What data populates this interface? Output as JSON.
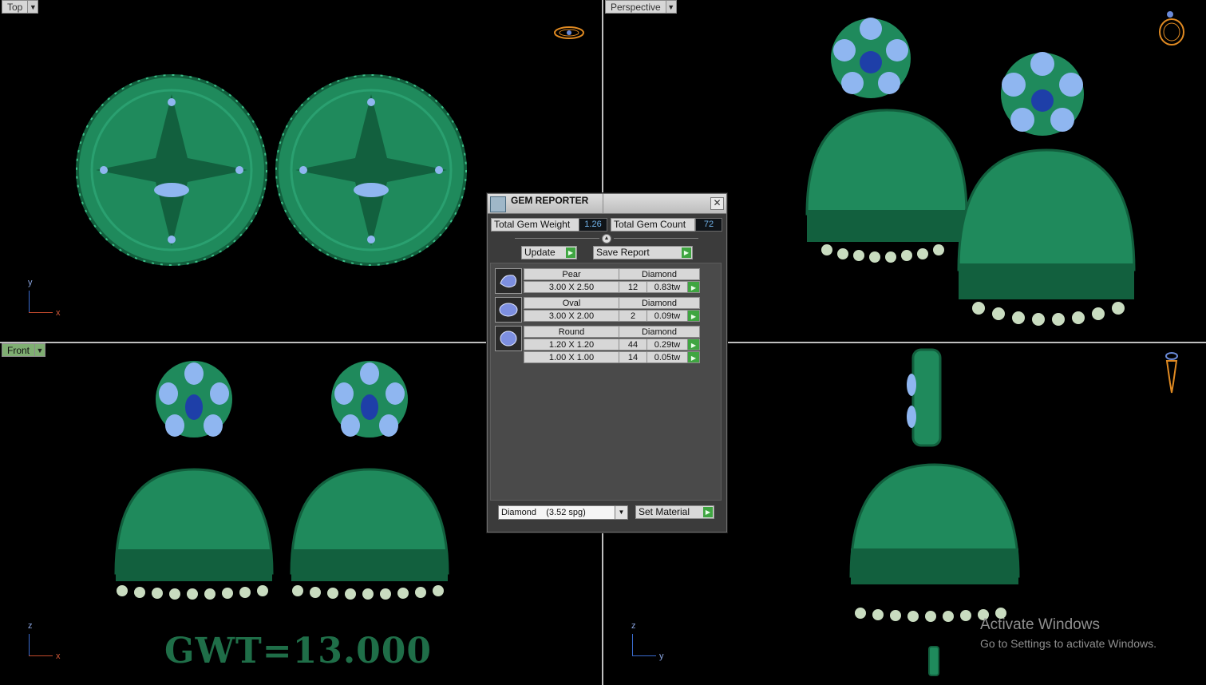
{
  "viewports": {
    "top": {
      "label": "Top"
    },
    "perspective": {
      "label": "Perspective"
    },
    "front": {
      "label": "Front"
    },
    "right": {
      "label": ""
    }
  },
  "axes": {
    "top": {
      "vertical": "y",
      "horizontal": "x"
    },
    "front": {
      "vertical": "z",
      "horizontal": "x"
    },
    "right": {
      "vertical": "z",
      "horizontal": "y"
    }
  },
  "overlay": {
    "gwt_text": "GWT=13.000",
    "watermark_title": "Activate Windows",
    "watermark_sub": "Go to Settings to activate Windows."
  },
  "gem_reporter": {
    "title": "GEM REPORTER",
    "close_symbol": "✕",
    "total_weight_label": "Total Gem Weight",
    "total_weight_value": "1.26",
    "total_count_label": "Total Gem Count",
    "total_count_value": "72",
    "update_label": "Update",
    "save_report_label": "Save Report",
    "rows": [
      {
        "shape": "Pear",
        "material": "Diamond",
        "sizes": [
          {
            "size": "3.00 X 2.50",
            "count": "12",
            "weight": "0.83tw"
          }
        ]
      },
      {
        "shape": "Oval",
        "material": "Diamond",
        "sizes": [
          {
            "size": "3.00 X 2.00",
            "count": "2",
            "weight": "0.09tw"
          }
        ]
      },
      {
        "shape": "Round",
        "material": "Diamond",
        "sizes": [
          {
            "size": "1.20 X 1.20",
            "count": "44",
            "weight": "0.29tw"
          },
          {
            "size": "1.00 X 1.00",
            "count": "14",
            "weight": "0.05tw"
          }
        ]
      }
    ],
    "material_select": "Diamond    (3.52 spg)",
    "set_material_label": "Set Material"
  },
  "colors": {
    "metal": "#1f8a5c",
    "metal_dark": "#12603e",
    "gem_light": "#8fb6f0",
    "gem_blue": "#1e3fa8",
    "pearl": "#c9dcc0",
    "active_label": "#7fae72"
  }
}
